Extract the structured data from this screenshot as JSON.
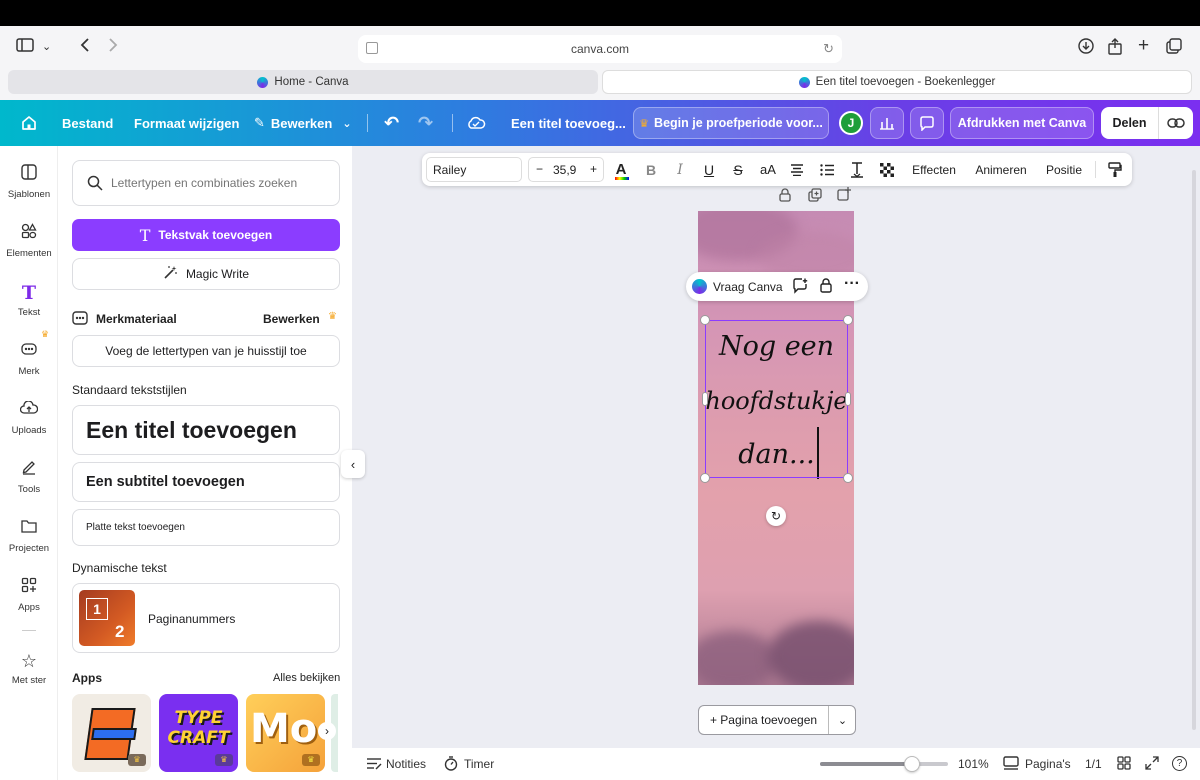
{
  "browser": {
    "url": "canva.com",
    "tabs": [
      {
        "label": "Home - Canva"
      },
      {
        "label": "Een titel toevoegen - Boekenlegger"
      }
    ]
  },
  "header": {
    "menu_file": "Bestand",
    "menu_resize": "Formaat wijzigen",
    "menu_edit": "Bewerken",
    "doc_title": "Een titel toevoeg...",
    "trial": "Begin je proefperiode voor...",
    "avatar_initial": "J",
    "print": "Afdrukken met Canva",
    "share": "Delen"
  },
  "rail": {
    "items": [
      {
        "label": "Sjablonen"
      },
      {
        "label": "Elementen"
      },
      {
        "label": "Tekst"
      },
      {
        "label": "Merk"
      },
      {
        "label": "Uploads"
      },
      {
        "label": "Tools"
      },
      {
        "label": "Projecten"
      },
      {
        "label": "Apps"
      },
      {
        "label": "Met ster"
      }
    ]
  },
  "panel": {
    "search_placeholder": "Lettertypen en combinaties zoeken",
    "add_textbox": "Tekstvak toevoegen",
    "magic_write": "Magic Write",
    "brand_title": "Merkmateriaal",
    "brand_edit": "Bewerken",
    "brand_fonts": "Voeg de lettertypen van je huisstijl toe",
    "default_styles": "Standaard tekststijlen",
    "title_style": "Een titel toevoegen",
    "subtitle_style": "Een subtitel toevoegen",
    "body_style": "Platte tekst toevoegen",
    "dynamic_text": "Dynamische tekst",
    "page_numbers": "Paginanummers",
    "page_num_1": "1",
    "page_num_2": "2",
    "apps_title": "Apps",
    "apps_all": "Alles bekijken",
    "app2_text": "TYPE CRAFT",
    "app3_text": "Mo"
  },
  "toolbar": {
    "font": "Railey",
    "size": "35,9",
    "minus": "−",
    "plus": "+",
    "bold": "B",
    "italic": "I",
    "underline": "U",
    "strike": "S",
    "case": "aA",
    "effects": "Effecten",
    "animate": "Animeren",
    "position": "Positie"
  },
  "canvas": {
    "ask_canva": "Vraag Canva",
    "text_lines": [
      "Nog een",
      "hoofdstukje",
      "dan..."
    ],
    "add_page": "+ Pagina toevoegen"
  },
  "bottom": {
    "notes": "Notities",
    "timer": "Timer",
    "zoom": "101%",
    "zoom_level": 0.72,
    "pages": "Pagina's",
    "page_count": "1/1"
  },
  "colors": {
    "accent": "#8b3dff",
    "add_textbox_bg": "#8b3dff",
    "avatar_bg": "#1e9e3a"
  }
}
